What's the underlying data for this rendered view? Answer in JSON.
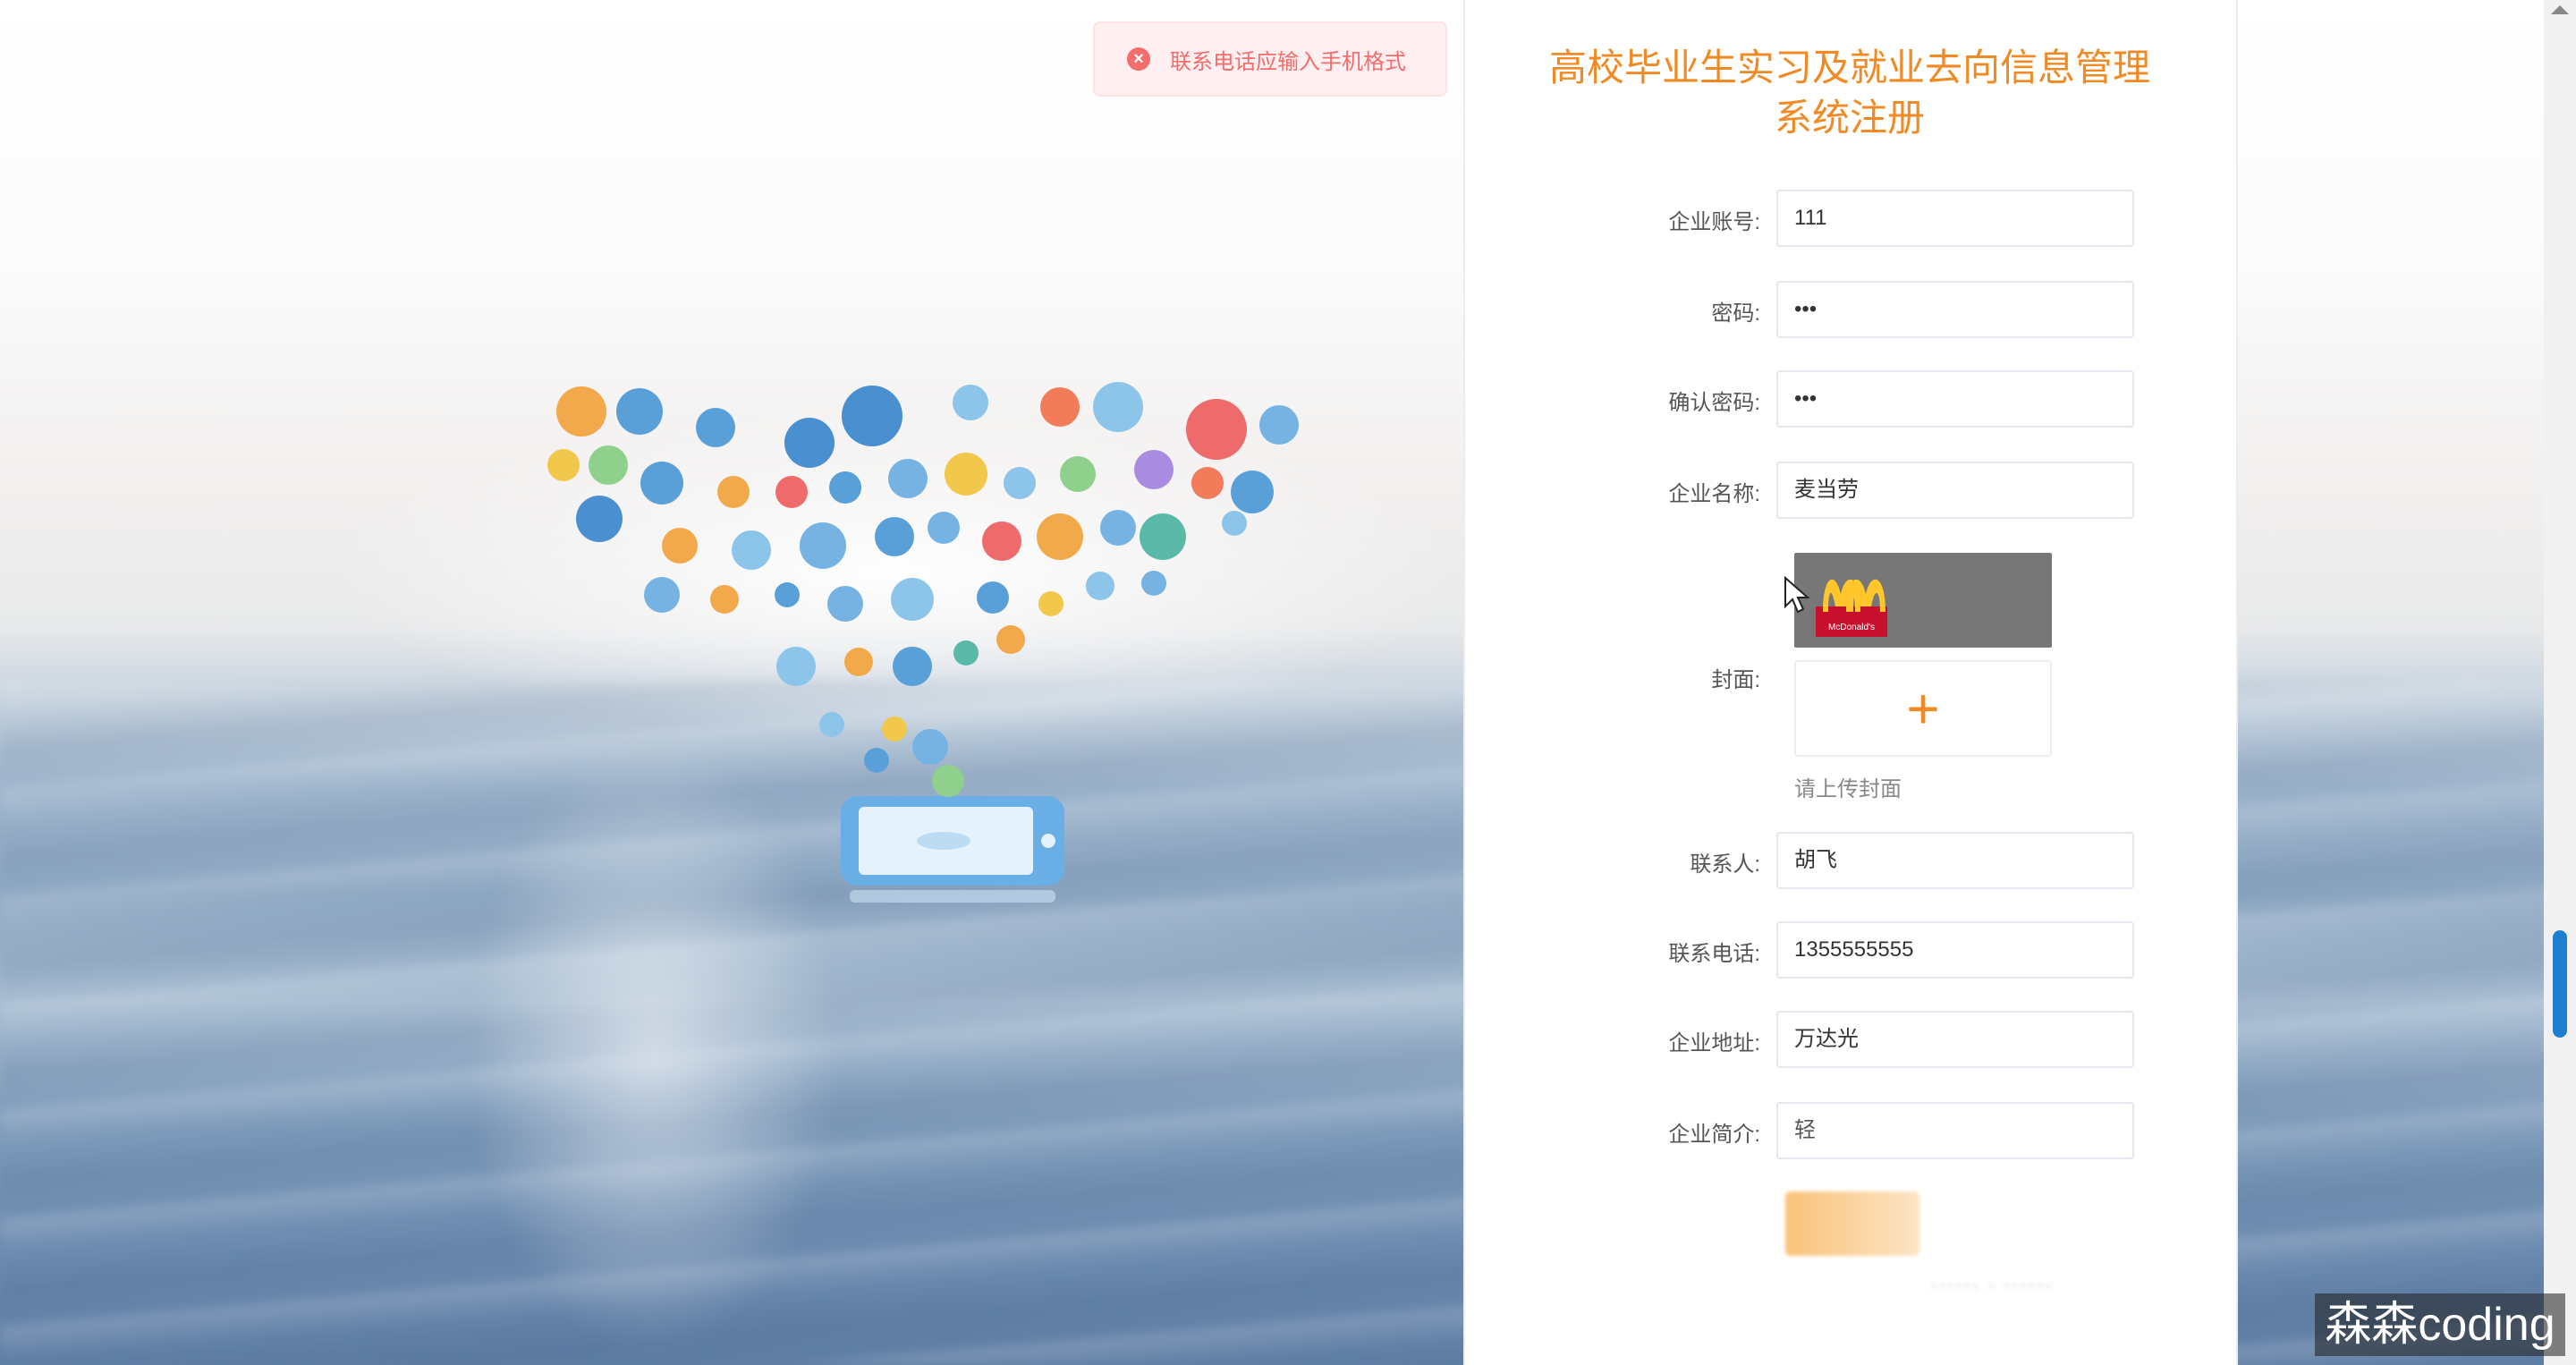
{
  "toast": {
    "message": "联系电话应输入手机格式",
    "icon": "error-circle-icon",
    "color": "#f56c6c"
  },
  "form": {
    "title": "高校毕业生实习及就业去向信息管理系统注册",
    "accent": "#f08a24",
    "fields": [
      {
        "label": "企业账号:",
        "value": "111"
      },
      {
        "label": "密码:",
        "value": "•••"
      },
      {
        "label": "确认密码:",
        "value": "•••"
      },
      {
        "label": "企业名称:",
        "value": "麦当劳"
      },
      {
        "label": "联系人:",
        "value": "胡飞"
      },
      {
        "label": "联系电话:",
        "value": "1355555555"
      },
      {
        "label": "企业地址:",
        "value": "万达光"
      },
      {
        "label": "企业简介:",
        "value": "轻"
      }
    ],
    "cover": {
      "label": "封面:",
      "logo_text": "McDonald's",
      "upload_hint": "请上传封面",
      "upload_icon": "plus-icon"
    }
  },
  "watermark": "森森coding"
}
